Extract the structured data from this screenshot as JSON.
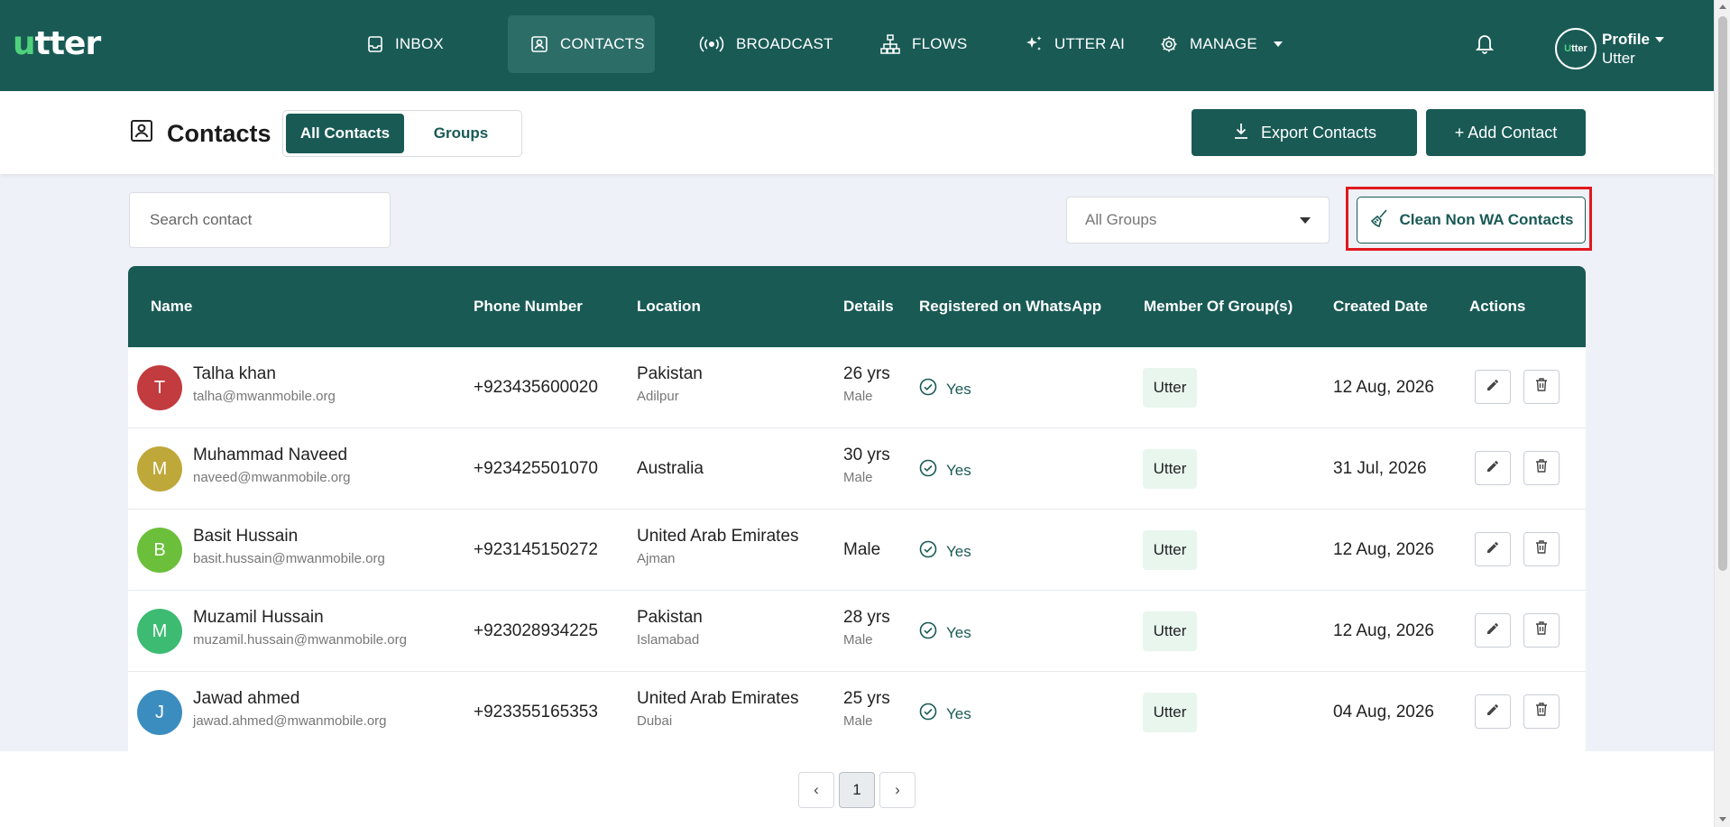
{
  "nav": {
    "logo_first": "u",
    "logo_rest": "tter",
    "items": [
      {
        "label": "INBOX",
        "icon": "inbox-icon"
      },
      {
        "label": "CONTACTS",
        "icon": "contact-card-icon",
        "active": true
      },
      {
        "label": "BROADCAST",
        "icon": "broadcast-icon"
      },
      {
        "label": "FLOWS",
        "icon": "flows-icon"
      },
      {
        "label": "UTTER AI",
        "icon": "sparkle-icon"
      },
      {
        "label": "MANAGE",
        "icon": "gear-icon"
      }
    ],
    "profile": {
      "avatar_first": "U",
      "avatar_rest": "tter",
      "name": "Profile",
      "org": "Utter"
    }
  },
  "header": {
    "title": "Contacts",
    "tabs": [
      "All Contacts",
      "Groups"
    ],
    "export_label": "Export Contacts",
    "add_label": "+ Add Contact"
  },
  "filters": {
    "search_placeholder": "Search contact",
    "group_select": "All Groups",
    "clean_label": "Clean Non WA Contacts"
  },
  "table": {
    "columns": [
      "Name",
      "Phone Number",
      "Location",
      "Details",
      "Registered on WhatsApp",
      "Member Of Group(s)",
      "Created Date",
      "Actions"
    ],
    "rows": [
      {
        "initial": "T",
        "color": "#c23b3e",
        "name": "Talha khan",
        "email": "talha@mwanmobile.org",
        "phone": "+923435600020",
        "country": "Pakistan",
        "city": "Adilpur",
        "age": "26 yrs",
        "gender": "Male",
        "registered": "Yes",
        "group": "Utter",
        "created": "12 Aug, 2026"
      },
      {
        "initial": "M",
        "color": "#bfa83a",
        "name": "Muhammad Naveed",
        "email": "naveed@mwanmobile.org",
        "phone": "+923425501070",
        "country": "Australia",
        "city": "",
        "age": "30 yrs",
        "gender": "Male",
        "registered": "Yes",
        "group": "Utter",
        "created": "31 Jul, 2026"
      },
      {
        "initial": "B",
        "color": "#6bbf3b",
        "name": "Basit Hussain",
        "email": "basit.hussain@mwanmobile.org",
        "phone": "+923145150272",
        "country": "United Arab Emirates",
        "city": "Ajman",
        "age": "",
        "gender": "Male",
        "registered": "Yes",
        "group": "Utter",
        "created": "12 Aug, 2026"
      },
      {
        "initial": "M",
        "color": "#3dbb73",
        "name": "Muzamil Hussain",
        "email": "muzamil.hussain@mwanmobile.org",
        "phone": "+923028934225",
        "country": "Pakistan",
        "city": "Islamabad",
        "age": "28 yrs",
        "gender": "Male",
        "registered": "Yes",
        "group": "Utter",
        "created": "12 Aug, 2026"
      },
      {
        "initial": "J",
        "color": "#3c8dbf",
        "name": "Jawad ahmed",
        "email": "jawad.ahmed@mwanmobile.org",
        "phone": "+923355165353",
        "country": "United Arab Emirates",
        "city": "Dubai",
        "age": "25 yrs",
        "gender": "Male",
        "registered": "Yes",
        "group": "Utter",
        "created": "04 Aug, 2026"
      }
    ]
  },
  "pagination": {
    "prev": "‹",
    "current": "1",
    "next": "›"
  },
  "colors": {
    "brand": "#195a55",
    "accent": "#4fd17c",
    "highlight": "#e0191e"
  }
}
